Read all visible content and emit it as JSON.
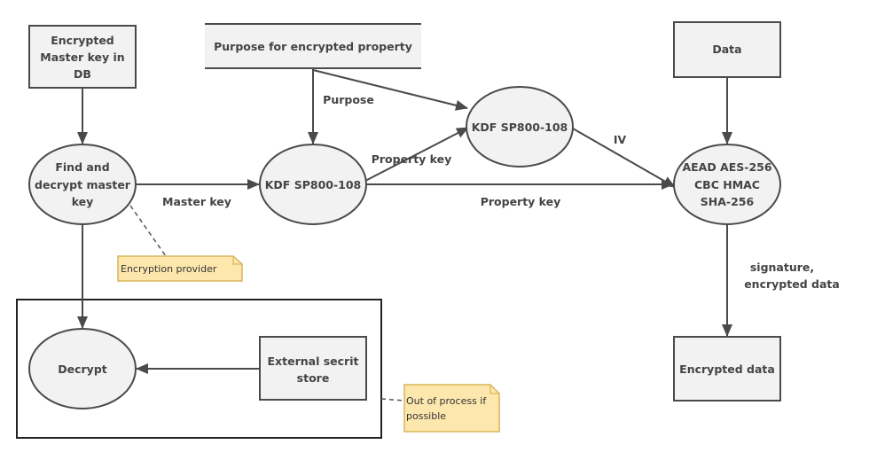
{
  "nodes": {
    "encrypted_master_key": [
      "Encrypted",
      "Master key in",
      "DB"
    ],
    "purpose": "Purpose for encrypted property",
    "data": "Data",
    "find_decrypt": [
      "Find and",
      "decrypt master",
      "key"
    ],
    "kdf1": "KDF SP800-108",
    "kdf2": "KDF SP800-108",
    "aead": [
      "AEAD AES-256",
      "CBC HMAC",
      "SHA-256"
    ],
    "encrypted_data": "Encrypted data",
    "decrypt": "Decrypt",
    "external_store": [
      "External secrit",
      "store"
    ]
  },
  "edges": {
    "master_key": "Master key",
    "purpose": "Purpose",
    "property_key_1": "Property key",
    "property_key_2": "Property key",
    "iv": "IV",
    "output": [
      "signature,",
      "encrypted data"
    ]
  },
  "notes": {
    "encryption_provider": "Encryption provider",
    "out_of_process": [
      "Out of process if",
      "possible"
    ]
  },
  "colors": {
    "shape_fill": "#f2f2f2",
    "stroke": "#4a4a4a",
    "note_fill": "#fde7ad"
  }
}
